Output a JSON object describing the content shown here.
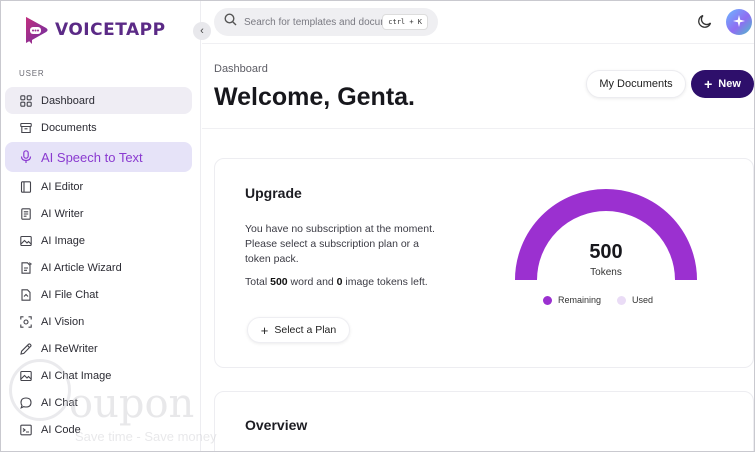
{
  "app": {
    "name": "VOICETAPP"
  },
  "header": {
    "search_placeholder": "Search for templates and documents...",
    "search_shortcut": "ctrl + K"
  },
  "sidebar": {
    "section_label": "USER",
    "items": [
      {
        "label": "Dashboard",
        "icon": "grid-icon"
      },
      {
        "label": "Documents",
        "icon": "archive-icon"
      },
      {
        "label": "AI Speech to Text",
        "icon": "microphone-icon"
      },
      {
        "label": "AI Editor",
        "icon": "book-icon"
      },
      {
        "label": "AI Writer",
        "icon": "document-icon"
      },
      {
        "label": "AI Image",
        "icon": "image-icon"
      },
      {
        "label": "AI Article Wizard",
        "icon": "wizard-icon"
      },
      {
        "label": "AI File Chat",
        "icon": "file-chat-icon"
      },
      {
        "label": "AI Vision",
        "icon": "scan-icon"
      },
      {
        "label": "AI ReWriter",
        "icon": "pen-icon"
      },
      {
        "label": "AI Chat Image",
        "icon": "image-icon"
      },
      {
        "label": "AI Chat",
        "icon": "chat-icon"
      },
      {
        "label": "AI Code",
        "icon": "terminal-icon"
      }
    ]
  },
  "main": {
    "breadcrumb": "Dashboard",
    "title": "Welcome, Genta.",
    "my_documents_label": "My Documents",
    "new_label": "New",
    "upgrade": {
      "title": "Upgrade",
      "description": "You have no subscription at the moment. Please select a subscription plan or a token pack.",
      "tokens_prefix": "Total ",
      "word_tokens": "500",
      "tokens_mid": " word and ",
      "image_tokens": "0",
      "tokens_suffix": " image tokens left.",
      "select_plan_label": "Select a Plan",
      "gauge_value": "500",
      "gauge_label": "Tokens",
      "remaining_fraction": 1.0,
      "legend_remaining": "Remaining",
      "legend_used": "Used",
      "color_remaining": "#9b30d0",
      "color_used": "#eadcf6"
    },
    "overview": {
      "title": "Overview"
    }
  },
  "watermark": {
    "text": "oupon",
    "subtext": "Save time - Save money"
  },
  "colors": {
    "brand": "#5b2a86",
    "accent": "#8a3ad0",
    "new_button": "#2e0f6b"
  }
}
